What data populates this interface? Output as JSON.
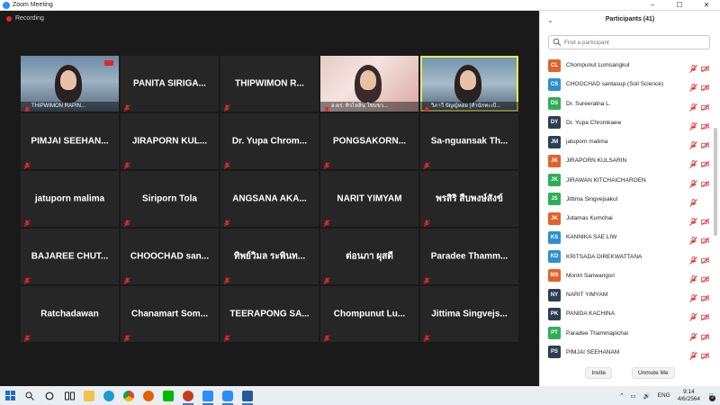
{
  "window": {
    "title": "Zoom Meeting",
    "minimize": "–",
    "maximize": "☐",
    "close": "✕"
  },
  "recording": {
    "label": "Recording"
  },
  "tiles": [
    {
      "name": "",
      "caption": "THIPWIMON RAPIN...",
      "type": "video1"
    },
    {
      "name": "PANITA SIRIGA...",
      "type": "name"
    },
    {
      "name": "THIPWIMON R...",
      "type": "name"
    },
    {
      "name": "",
      "caption": "อ.ดร. ทิวไหลิน โชบขว...",
      "type": "video2"
    },
    {
      "name": "",
      "caption": "วิภาวี ปัญญ์หอ่ย (สำนักทะเบี...",
      "type": "video3"
    },
    {
      "name": "PIMJAI SEEHAN...",
      "type": "name"
    },
    {
      "name": "JIRAPORN KUL...",
      "type": "name"
    },
    {
      "name": "Dr. Yupa Chrom...",
      "type": "name"
    },
    {
      "name": "PONGSAKORN...",
      "type": "name"
    },
    {
      "name": "Sa-nguansak Th...",
      "type": "name"
    },
    {
      "name": "jatuporn malima",
      "type": "name"
    },
    {
      "name": "Siriporn Tola",
      "type": "name"
    },
    {
      "name": "ANGSANA AKA...",
      "type": "name"
    },
    {
      "name": "NARIT YIMYAM",
      "type": "name"
    },
    {
      "name": "พรสิริ สืบพงษ์สังข์",
      "type": "name"
    },
    {
      "name": "BAJAREE CHUT...",
      "type": "name"
    },
    {
      "name": "CHOOCHAD san...",
      "type": "name"
    },
    {
      "name": "ทิพย์วิมล ระพินท...",
      "type": "name"
    },
    {
      "name": "ต่อนภา ผุสดี",
      "type": "name"
    },
    {
      "name": "Paradee Thamm...",
      "type": "name"
    },
    {
      "name": "Ratchadawan",
      "type": "name"
    },
    {
      "name": "Chanamart Som...",
      "type": "name"
    },
    {
      "name": "TEERAPONG SA...",
      "type": "name"
    },
    {
      "name": "Chompunut Lu...",
      "type": "name"
    },
    {
      "name": "Jittima Singvejs...",
      "type": "name"
    }
  ],
  "participants": {
    "title": "Participants (41)",
    "search_placeholder": "Find a participant",
    "items": [
      {
        "initials": "CL",
        "name": "Chompunut Lumsangkul",
        "color": "#e0632d",
        "video_off": true
      },
      {
        "initials": "CS",
        "name": "CHOOCHAD santasup (Soil Science)",
        "color": "#2f8fce",
        "video_off": true
      },
      {
        "initials": "DS",
        "name": "Dr. Sureeratna L.",
        "color": "#2fae5a",
        "video_off": true
      },
      {
        "initials": "DY",
        "name": "Dr. Yupa Chromkaew",
        "color": "#2d3e50",
        "video_off": true
      },
      {
        "initials": "JM",
        "name": "jatuporn malima",
        "color": "#2d3e50",
        "video_off": true
      },
      {
        "initials": "JK",
        "name": "JIRAPORN KULSARIN",
        "color": "#e0632d",
        "video_off": true
      },
      {
        "initials": "JK",
        "name": "JIRAWAN KITCHAICHAROEN",
        "color": "#2fae5a",
        "video_off": true
      },
      {
        "initials": "JS",
        "name": "Jittima Singvejsakul",
        "color": "#2fae5a",
        "video_off": false
      },
      {
        "initials": "JK",
        "name": "Jutamas Kumchai",
        "color": "#e0632d",
        "video_off": true
      },
      {
        "initials": "KS",
        "name": "KANNIKA SAE LIW",
        "color": "#2f8fce",
        "video_off": true
      },
      {
        "initials": "KD",
        "name": "KRITSADA DIREKWATTANA",
        "color": "#2f8fce",
        "video_off": true
      },
      {
        "initials": "MS",
        "name": "Montri Sanwangsri",
        "color": "#e0632d",
        "video_off": true
      },
      {
        "initials": "NY",
        "name": "NARIT YIMYAM",
        "color": "#2d3e50",
        "video_off": true
      },
      {
        "initials": "PK",
        "name": "PANIDA KACHINA",
        "color": "#2d3e50",
        "video_off": true
      },
      {
        "initials": "PT",
        "name": "Paradee Thammapichai",
        "color": "#2fae5a",
        "video_off": true
      },
      {
        "initials": "PS",
        "name": "PIMJAI SEEHANAM",
        "color": "#2d3e50",
        "video_off": true
      }
    ],
    "invite_label": "Invite",
    "unmute_label": "Unmute Me"
  },
  "taskbar": {
    "language": "ENG",
    "time": "9:14",
    "date": "4/6/2564",
    "notification_count": "2",
    "tray_chevron": "^"
  },
  "colors": {
    "accent": "#2d8cff",
    "muted_red": "#e02828",
    "active_speaker": "#e5e95a"
  }
}
